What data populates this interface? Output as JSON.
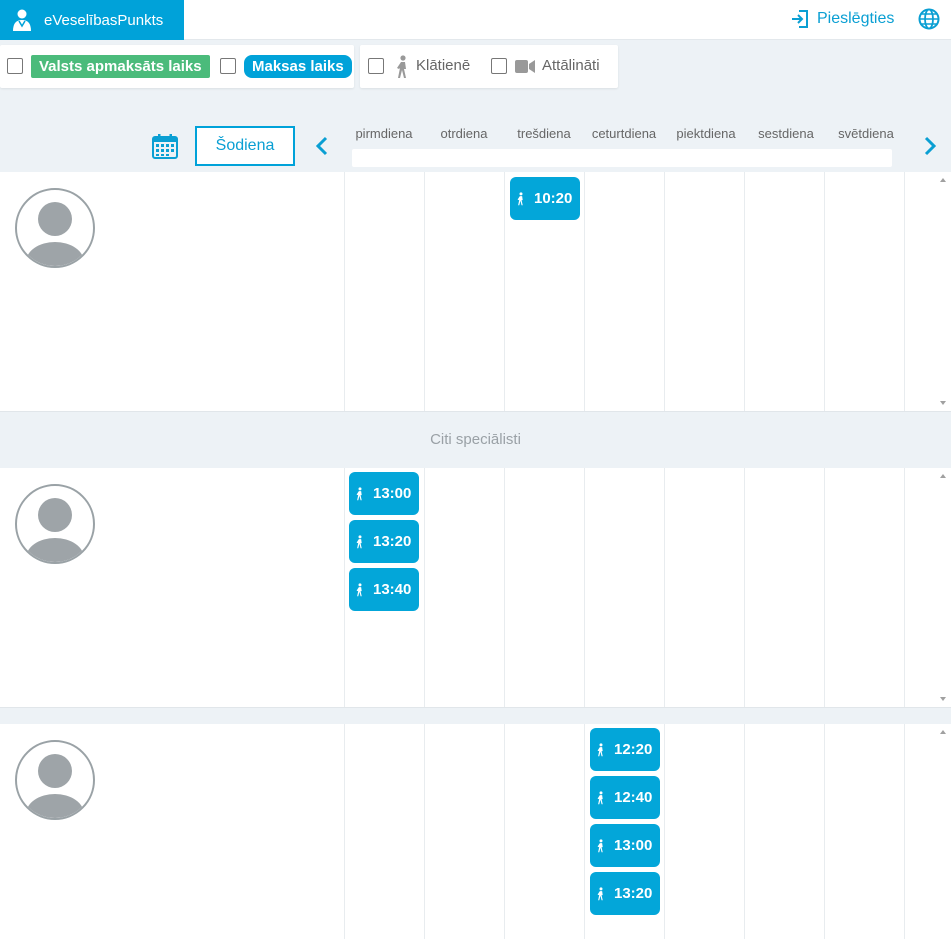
{
  "header": {
    "brand": "eVeselībasPunkts",
    "login_label": "Pieslēgties"
  },
  "filters": {
    "state_paid": "Valsts apmaksāts laiks",
    "paid": "Maksas laiks",
    "in_person": "Klātienē",
    "remote": "Attālināti"
  },
  "calendar": {
    "today_label": "Šodiena",
    "days": [
      "pirmdiena",
      "otrdiena",
      "trešdiena",
      "ceturtdiena",
      "piektdiena",
      "sestdiena",
      "svētdiena"
    ]
  },
  "sections": {
    "other_specialists": "Citi speciālisti"
  },
  "colors": {
    "accent": "#00a2d9",
    "green": "#4bbb7b"
  },
  "panels": [
    {
      "slots": [
        {
          "day": 2,
          "time": "10:20"
        }
      ]
    },
    {
      "slots": [
        {
          "day": 0,
          "time": "13:00"
        },
        {
          "day": 0,
          "time": "13:20"
        },
        {
          "day": 0,
          "time": "13:40"
        }
      ]
    },
    {
      "slots": [
        {
          "day": 3,
          "time": "12:20"
        },
        {
          "day": 3,
          "time": "12:40"
        },
        {
          "day": 3,
          "time": "13:00"
        },
        {
          "day": 3,
          "time": "13:20"
        }
      ]
    }
  ]
}
